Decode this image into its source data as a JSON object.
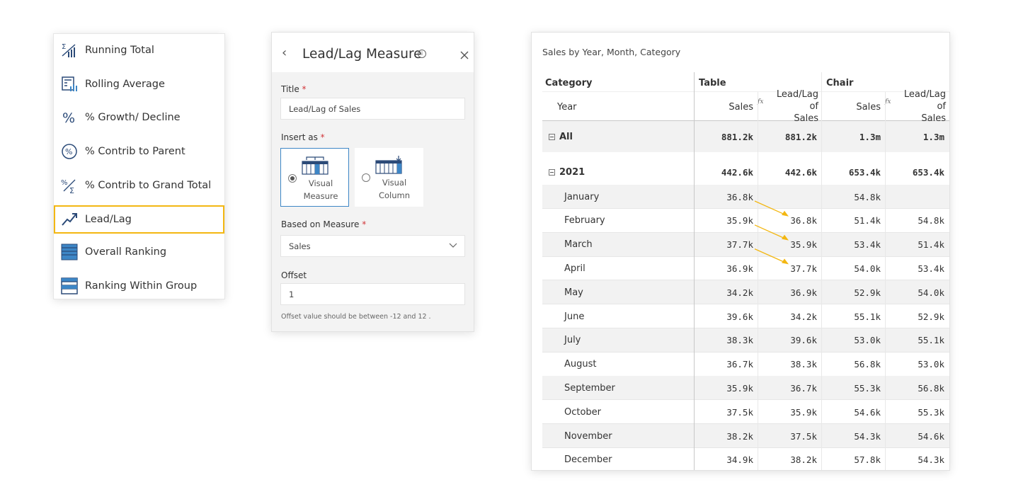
{
  "menu": {
    "items": [
      {
        "label": "Running Total",
        "icon": "running-total-icon"
      },
      {
        "label": "Rolling Average",
        "icon": "rolling-average-icon"
      },
      {
        "label": "% Growth/ Decline",
        "icon": "percent-icon"
      },
      {
        "label": "% Contrib to Parent",
        "icon": "percent-circle-icon"
      },
      {
        "label": "% Contrib to Grand Total",
        "icon": "percent-sum-icon"
      },
      {
        "label": "Lead/Lag",
        "icon": "trend-arrow-icon",
        "selected": true
      },
      {
        "label": "Overall Ranking",
        "icon": "ranking-table-icon"
      },
      {
        "label": "Ranking Within Group",
        "icon": "ranking-group-icon"
      }
    ],
    "selected_color": "#f3b712"
  },
  "dialog": {
    "title": "Lead/Lag Measure",
    "title_label": "Title",
    "title_value": "Lead/Lag of Sales",
    "required_mark": "*",
    "insert_as_label": "Insert as",
    "option_measure_line1": "Visual",
    "option_measure_line2": "Measure",
    "option_column_line1": "Visual",
    "option_column_line2": "Column",
    "based_on_label": "Based on Measure",
    "based_on_value": "Sales",
    "offset_label": "Offset",
    "offset_value": "1",
    "hint": "Offset value should be between -12 and 12 ."
  },
  "table": {
    "title": "Sales by Year, Month, Category",
    "category_header": "Category",
    "year_header": "Year",
    "group_table": "Table",
    "group_chair": "Chair",
    "col_sales": "Sales",
    "col_leadlag": "Lead/Lag of Sales",
    "col_leadlag_line1": "Lead/Lag of",
    "col_leadlag_line2": "Sales",
    "fx": "fx",
    "all": {
      "label": "All",
      "values": [
        "881.2k",
        "881.2k",
        "1.3m",
        "1.3m"
      ]
    },
    "year": {
      "label": "2021",
      "values": [
        "442.6k",
        "442.6k",
        "653.4k",
        "653.4k"
      ]
    },
    "months": [
      {
        "label": "January",
        "values": [
          "36.8k",
          "",
          "54.8k",
          ""
        ]
      },
      {
        "label": "February",
        "values": [
          "35.9k",
          "36.8k",
          "51.4k",
          "54.8k"
        ]
      },
      {
        "label": "March",
        "values": [
          "37.7k",
          "35.9k",
          "53.4k",
          "51.4k"
        ]
      },
      {
        "label": "April",
        "values": [
          "36.9k",
          "37.7k",
          "54.0k",
          "53.4k"
        ]
      },
      {
        "label": "May",
        "values": [
          "34.2k",
          "36.9k",
          "52.9k",
          "54.0k"
        ]
      },
      {
        "label": "June",
        "values": [
          "39.6k",
          "34.2k",
          "55.1k",
          "52.9k"
        ]
      },
      {
        "label": "July",
        "values": [
          "38.3k",
          "39.6k",
          "53.0k",
          "55.1k"
        ]
      },
      {
        "label": "August",
        "values": [
          "36.7k",
          "38.3k",
          "56.8k",
          "53.0k"
        ]
      },
      {
        "label": "September",
        "values": [
          "35.9k",
          "36.7k",
          "55.3k",
          "56.8k"
        ]
      },
      {
        "label": "October",
        "values": [
          "37.5k",
          "35.9k",
          "54.6k",
          "55.3k"
        ]
      },
      {
        "label": "November",
        "values": [
          "38.2k",
          "37.5k",
          "54.3k",
          "54.6k"
        ]
      },
      {
        "label": "December",
        "values": [
          "34.9k",
          "38.2k",
          "57.8k",
          "54.3k"
        ]
      }
    ],
    "arrow_color": "#f3b712"
  }
}
